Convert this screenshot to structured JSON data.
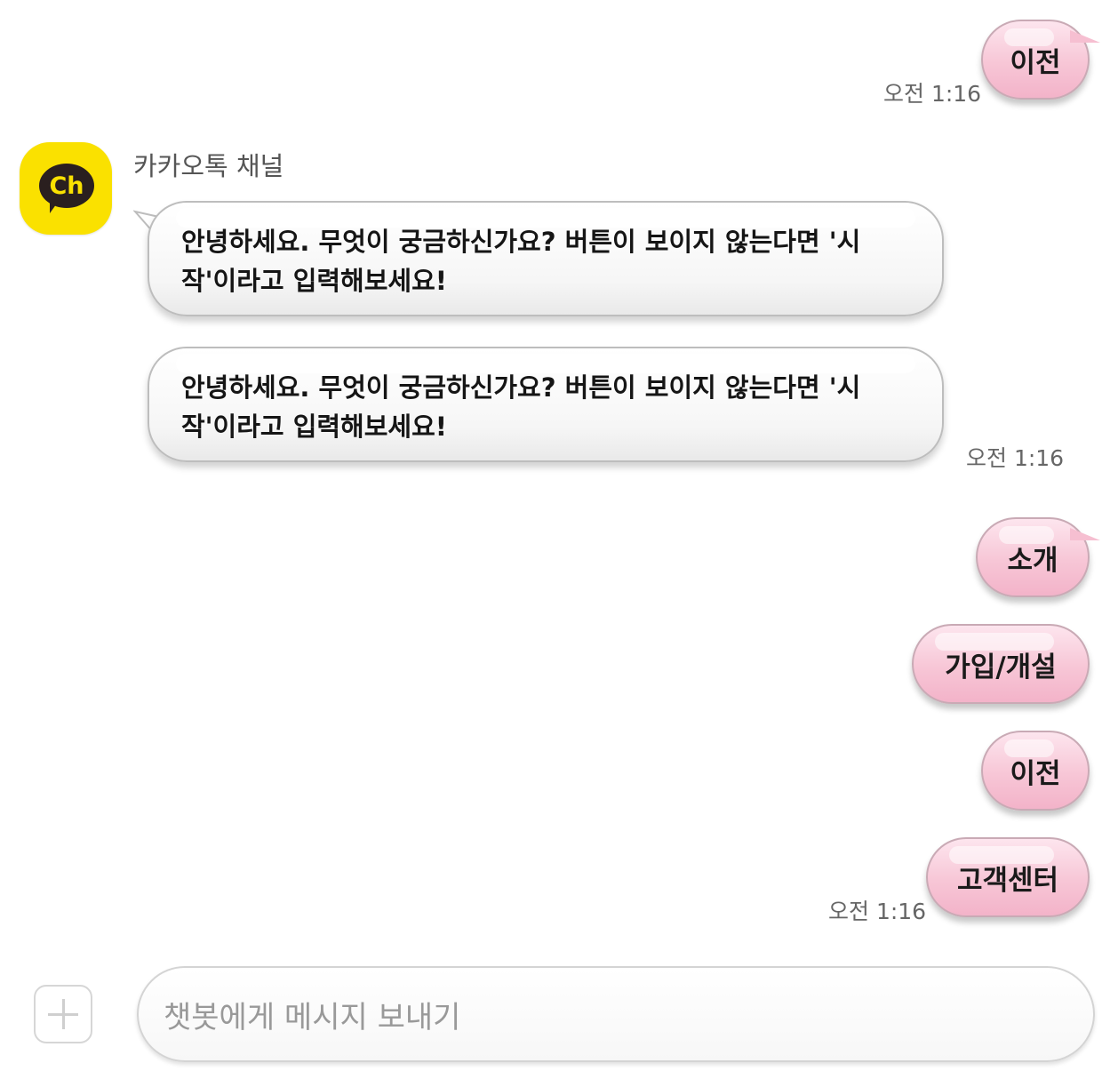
{
  "messages": {
    "top_button": {
      "label": "이전",
      "time": "오전 1:16"
    },
    "bot": {
      "name": "카카오톡 채널",
      "avatar_label": "Ch",
      "message_1": "안녕하세요. 무엇이 궁금하신가요? 버튼이 보이지 않는다면 '시작'이라고 입력해보세요!",
      "message_2": "안녕하세요. 무엇이 궁금하신가요? 버튼이 보이지 않는다면 '시작'이라고 입력해보세요!",
      "time": "오전 1:16"
    },
    "quick_replies": {
      "items": [
        {
          "label": "소개"
        },
        {
          "label": "가입/개설"
        },
        {
          "label": "이전"
        },
        {
          "label": "고객센터"
        }
      ],
      "time": "오전 1:16"
    }
  },
  "composer": {
    "placeholder": "챗봇에게 메시지 보내기"
  },
  "colors": {
    "channel_yellow": "#fae100",
    "bubble_pink": "#f7c6d6",
    "bubble_white": "#ffffff"
  }
}
